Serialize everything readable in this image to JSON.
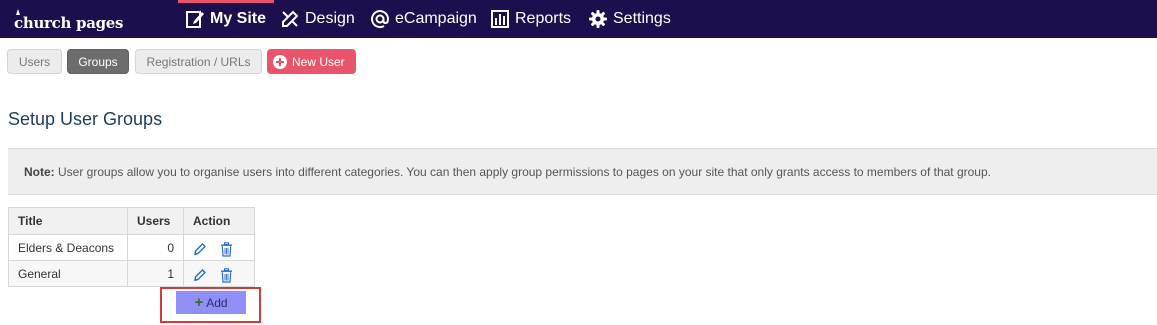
{
  "brand": {
    "logo_text": "church pages"
  },
  "nav": {
    "items": [
      {
        "label": "My Site",
        "icon": "edit-page-icon",
        "active": true
      },
      {
        "label": "Design",
        "icon": "pencil-ruler-icon",
        "active": false
      },
      {
        "label": "eCampaign",
        "icon": "at-sign-icon",
        "active": false
      },
      {
        "label": "Reports",
        "icon": "bar-chart-icon",
        "active": false
      },
      {
        "label": "Settings",
        "icon": "gear-icon",
        "active": false
      }
    ]
  },
  "subtabs": {
    "items": [
      {
        "label": "Users",
        "active": false
      },
      {
        "label": "Groups",
        "active": true
      },
      {
        "label": "Registration / URLs",
        "active": false
      }
    ],
    "new_user_label": "New User"
  },
  "page": {
    "title": "Setup User Groups"
  },
  "note": {
    "label": "Note:",
    "text": "User groups allow you to organise users into different categories. You can then apply group permissions to pages on your site that only grants access to members of that group."
  },
  "table": {
    "headers": {
      "title": "Title",
      "users": "Users",
      "action": "Action"
    },
    "rows": [
      {
        "title": "Elders & Deacons",
        "users": "0"
      },
      {
        "title": "General",
        "users": "1"
      }
    ]
  },
  "add_button": {
    "label": "Add"
  },
  "colors": {
    "topbar": "#1d0e4d",
    "accent": "#e8546b",
    "add_button": "#8f8ff5",
    "highlight_border": "#d33a3a"
  }
}
